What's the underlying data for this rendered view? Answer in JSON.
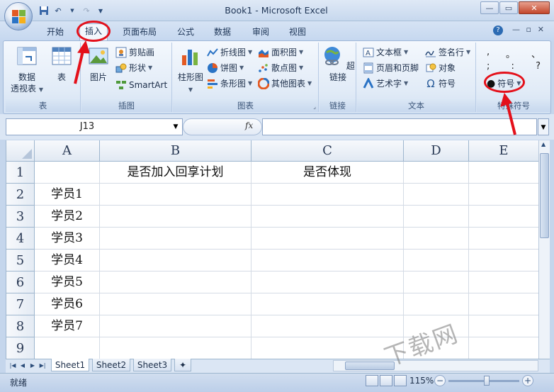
{
  "window": {
    "title": "Book1 - Microsoft Excel"
  },
  "quick_access": {
    "icons": [
      "save-icon",
      "undo-icon",
      "redo-icon",
      "customize-icon"
    ]
  },
  "ribbon_tabs": [
    {
      "label": "开始",
      "active": false
    },
    {
      "label": "插入",
      "active": true
    },
    {
      "label": "页面布局",
      "active": false
    },
    {
      "label": "公式",
      "active": false
    },
    {
      "label": "数据",
      "active": false
    },
    {
      "label": "审阅",
      "active": false
    },
    {
      "label": "视图",
      "active": false
    }
  ],
  "groups": {
    "table": {
      "label": "表",
      "pivot_label": "数据\n透视表",
      "table_label": "表"
    },
    "illustrations": {
      "label": "插图",
      "picture": "图片",
      "clipart": "剪贴画",
      "shapes": "形状",
      "smartart": "SmartArt"
    },
    "charts": {
      "label": "图表",
      "column": "柱形图",
      "line": "折线图",
      "pie": "饼图",
      "bar": "条形图",
      "area": "面积图",
      "scatter": "散点图",
      "other": "其他图表"
    },
    "links": {
      "label": "链接",
      "hyperlink": "超链接"
    },
    "text": {
      "label": "文本",
      "textbox": "文本框",
      "header_footer": "页眉和页脚",
      "wordart": "艺术字",
      "signature": "签名行",
      "object": "对象",
      "symbol": "符号"
    },
    "special": {
      "label": "特殊符号",
      "symbol_btn": "符号",
      "glyphs": [
        ",",
        "。",
        "、",
        ";",
        ":",
        "?"
      ]
    }
  },
  "formula_bar": {
    "name_box": "J13",
    "fx": "fx",
    "formula": ""
  },
  "sheet": {
    "columns": [
      "A",
      "B",
      "C",
      "D",
      "E"
    ],
    "rows": [
      "1",
      "2",
      "3",
      "4",
      "5",
      "6",
      "7",
      "8",
      "9"
    ],
    "cells": {
      "B1": "是否加入回享计划",
      "C1": "是否体现",
      "A2": "学员1",
      "A3": "学员2",
      "A4": "学员3",
      "A5": "学员4",
      "A6": "学员5",
      "A7": "学员6",
      "A8": "学员7"
    }
  },
  "sheet_tabs": [
    "Sheet1",
    "Sheet2",
    "Sheet3"
  ],
  "status": {
    "ready": "就绪",
    "zoom": "115%"
  },
  "watermark": "下载网",
  "colors": {
    "annotation_red": "#e4101a",
    "ribbon_blue": "#c5d6ec"
  }
}
